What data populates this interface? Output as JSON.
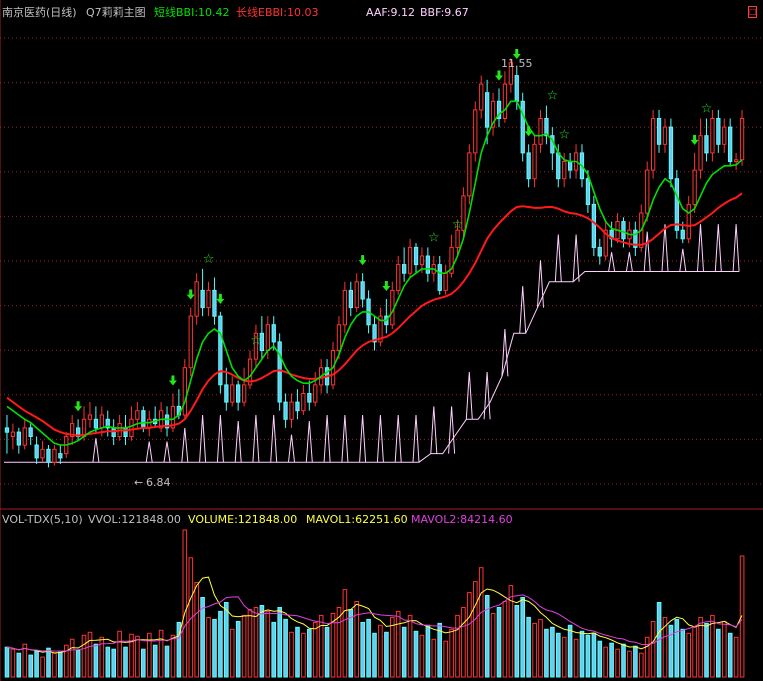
{
  "colors": {
    "up": "#ff3232",
    "down": "#54ffff",
    "down_fill": "#6cc8ec",
    "short_line": "#00e000",
    "long_line": "#ff1a1a",
    "aaf_line": "#ffd0ff",
    "grid": "#a02020",
    "arrow": "#22e81a",
    "mavol1": "#ffff40",
    "mavol2": "#e040e0",
    "label": "#c0c0c0"
  },
  "main_header": {
    "stock": "南京医药(日线)",
    "indicator": "Q7莉莉主图",
    "short_label": "短线BBI:10.42",
    "long_label": "长线EBBI:10.03",
    "aaf_label": "AAF:9.12",
    "bbf_label": "BBF:9.67"
  },
  "vol_header": {
    "name": "VOL-TDX(5,10)",
    "vvol": "VVOL:121848.00",
    "volume": "VOLUME:121848.00",
    "mavol1": "MAVOL1:62251.60",
    "mavol2": "MAVOL2:84214.60"
  },
  "annotations": {
    "high_label": "11.55",
    "low_label": "6.84"
  },
  "window_button_glyph": "□",
  "chart_data": [
    {
      "type": "candlestick",
      "title": "南京医药(日线) Q7莉莉主图",
      "price_range": [
        6.6,
        12.0
      ],
      "high_marker": 11.55,
      "low_marker": 6.84,
      "last_values": {
        "short_bbi": 10.42,
        "long_ebbi": 10.03,
        "aaf": 9.12,
        "bbf": 9.67
      },
      "candles": [
        [
          7.3,
          7.25,
          7.0,
          7.45
        ],
        [
          7.2,
          7.25,
          7.05,
          7.35
        ],
        [
          7.25,
          7.1,
          7.0,
          7.3
        ],
        [
          7.1,
          7.3,
          7.05,
          7.4
        ],
        [
          7.3,
          7.2,
          7.1,
          7.35
        ],
        [
          7.1,
          6.95,
          6.88,
          7.2
        ],
        [
          6.95,
          7.05,
          6.9,
          7.15
        ],
        [
          7.05,
          6.9,
          6.84,
          7.1
        ],
        [
          6.9,
          7.05,
          6.86,
          7.1
        ],
        [
          7.0,
          6.95,
          6.88,
          7.1
        ],
        [
          7.0,
          7.2,
          6.95,
          7.25
        ],
        [
          7.2,
          7.35,
          7.1,
          7.45
        ],
        [
          7.3,
          7.2,
          7.15,
          7.4
        ],
        [
          7.2,
          7.4,
          7.15,
          7.55
        ],
        [
          7.4,
          7.45,
          7.3,
          7.6
        ],
        [
          7.4,
          7.3,
          7.25,
          7.55
        ],
        [
          7.3,
          7.45,
          7.2,
          7.55
        ],
        [
          7.4,
          7.3,
          7.2,
          7.5
        ],
        [
          7.3,
          7.2,
          7.1,
          7.4
        ],
        [
          7.2,
          7.35,
          7.15,
          7.45
        ],
        [
          7.3,
          7.2,
          7.1,
          7.45
        ],
        [
          7.2,
          7.4,
          7.15,
          7.55
        ],
        [
          7.4,
          7.5,
          7.3,
          7.6
        ],
        [
          7.5,
          7.3,
          7.25,
          7.55
        ],
        [
          7.3,
          7.4,
          7.2,
          7.5
        ],
        [
          7.4,
          7.35,
          7.3,
          7.55
        ],
        [
          7.3,
          7.5,
          7.25,
          7.6
        ],
        [
          7.45,
          7.3,
          7.2,
          7.55
        ],
        [
          7.3,
          7.55,
          7.25,
          7.7
        ],
        [
          7.55,
          7.45,
          7.4,
          7.75
        ],
        [
          7.45,
          8.0,
          7.4,
          8.1
        ],
        [
          8.0,
          8.6,
          7.9,
          8.7
        ],
        [
          8.6,
          9.0,
          8.5,
          9.1
        ],
        [
          8.9,
          8.7,
          8.6,
          9.15
        ],
        [
          8.7,
          8.9,
          8.6,
          9.0
        ],
        [
          8.9,
          8.6,
          8.5,
          9.05
        ],
        [
          8.6,
          7.8,
          7.7,
          8.65
        ],
        [
          7.8,
          7.6,
          7.5,
          8.0
        ],
        [
          7.6,
          7.8,
          7.55,
          7.9
        ],
        [
          7.8,
          7.6,
          7.5,
          7.85
        ],
        [
          7.6,
          7.8,
          7.55,
          8.0
        ],
        [
          7.8,
          8.1,
          7.75,
          8.2
        ],
        [
          8.1,
          8.4,
          8.0,
          8.5
        ],
        [
          8.4,
          8.2,
          8.1,
          8.6
        ],
        [
          8.2,
          8.5,
          8.1,
          8.6
        ],
        [
          8.5,
          8.3,
          8.2,
          8.6
        ],
        [
          8.3,
          7.6,
          7.5,
          8.4
        ],
        [
          7.6,
          7.4,
          7.3,
          7.7
        ],
        [
          7.4,
          7.6,
          7.3,
          7.7
        ],
        [
          7.6,
          7.5,
          7.4,
          7.75
        ],
        [
          7.5,
          7.7,
          7.45,
          7.8
        ],
        [
          7.7,
          7.6,
          7.5,
          7.85
        ],
        [
          7.6,
          7.8,
          7.55,
          7.95
        ],
        [
          7.8,
          8.0,
          7.7,
          8.1
        ],
        [
          8.0,
          7.8,
          7.7,
          8.1
        ],
        [
          7.8,
          8.2,
          7.75,
          8.3
        ],
        [
          8.2,
          8.5,
          8.1,
          8.6
        ],
        [
          8.5,
          8.9,
          8.4,
          9.0
        ],
        [
          8.9,
          8.7,
          8.6,
          9.0
        ],
        [
          8.7,
          9.0,
          8.65,
          9.1
        ],
        [
          9.0,
          8.8,
          8.7,
          9.1
        ],
        [
          8.8,
          8.5,
          8.4,
          8.9
        ],
        [
          8.5,
          8.3,
          8.2,
          8.6
        ],
        [
          8.3,
          8.6,
          8.25,
          8.7
        ],
        [
          8.6,
          8.5,
          8.4,
          8.8
        ],
        [
          8.5,
          8.9,
          8.45,
          9.0
        ],
        [
          8.9,
          9.2,
          8.85,
          9.3
        ],
        [
          9.2,
          9.1,
          9.0,
          9.4
        ],
        [
          9.1,
          9.4,
          9.05,
          9.5
        ],
        [
          9.4,
          9.2,
          9.1,
          9.45
        ],
        [
          9.2,
          9.3,
          9.1,
          9.4
        ],
        [
          9.3,
          9.1,
          9.0,
          9.4
        ],
        [
          9.1,
          9.2,
          9.0,
          9.3
        ],
        [
          9.2,
          8.9,
          8.85,
          9.3
        ],
        [
          8.9,
          9.1,
          8.85,
          9.2
        ],
        [
          9.1,
          9.4,
          9.05,
          9.55
        ],
        [
          9.4,
          9.6,
          9.3,
          9.7
        ],
        [
          9.6,
          10.0,
          9.5,
          10.1
        ],
        [
          10.0,
          10.5,
          9.9,
          10.6
        ],
        [
          10.5,
          11.0,
          10.4,
          11.1
        ],
        [
          11.0,
          11.3,
          10.9,
          11.4
        ],
        [
          11.2,
          10.8,
          10.6,
          11.35
        ],
        [
          10.8,
          11.1,
          10.7,
          11.2
        ],
        [
          11.1,
          10.9,
          10.8,
          11.25
        ],
        [
          10.9,
          11.3,
          10.85,
          11.45
        ],
        [
          11.3,
          11.55,
          11.2,
          11.6
        ],
        [
          11.4,
          11.1,
          11.0,
          11.5
        ],
        [
          11.1,
          10.5,
          10.4,
          11.2
        ],
        [
          10.5,
          10.2,
          10.1,
          10.6
        ],
        [
          10.2,
          10.6,
          10.1,
          10.7
        ],
        [
          10.6,
          10.9,
          10.5,
          11.0
        ],
        [
          10.9,
          10.7,
          10.6,
          11.05
        ],
        [
          10.7,
          10.5,
          10.3,
          10.8
        ],
        [
          10.5,
          10.2,
          10.1,
          10.6
        ],
        [
          10.2,
          10.4,
          10.1,
          10.5
        ],
        [
          10.4,
          10.3,
          10.2,
          10.5
        ],
        [
          10.3,
          10.5,
          10.2,
          10.6
        ],
        [
          10.5,
          10.2,
          10.1,
          10.6
        ],
        [
          10.2,
          9.9,
          9.8,
          10.3
        ],
        [
          9.9,
          9.4,
          9.3,
          10.0
        ],
        [
          9.4,
          9.3,
          9.2,
          9.5
        ],
        [
          9.3,
          9.6,
          9.25,
          9.7
        ],
        [
          9.6,
          9.5,
          9.4,
          9.7
        ],
        [
          9.5,
          9.7,
          9.45,
          9.8
        ],
        [
          9.7,
          9.5,
          9.4,
          9.75
        ],
        [
          9.5,
          9.6,
          9.4,
          9.7
        ],
        [
          9.6,
          9.4,
          9.3,
          9.7
        ],
        [
          9.4,
          9.8,
          9.35,
          9.9
        ],
        [
          9.8,
          10.3,
          9.7,
          10.4
        ],
        [
          10.3,
          10.9,
          10.2,
          11.0
        ],
        [
          10.9,
          10.6,
          10.5,
          11.0
        ],
        [
          10.6,
          10.8,
          10.5,
          10.9
        ],
        [
          10.8,
          10.2,
          10.1,
          10.9
        ],
        [
          10.2,
          9.6,
          9.5,
          10.3
        ],
        [
          9.6,
          9.5,
          9.45,
          9.7
        ],
        [
          9.5,
          9.9,
          9.45,
          10.0
        ],
        [
          9.9,
          10.3,
          9.8,
          10.5
        ],
        [
          10.3,
          10.7,
          10.2,
          10.9
        ],
        [
          10.7,
          10.5,
          10.4,
          10.9
        ],
        [
          10.5,
          10.9,
          10.4,
          11.0
        ],
        [
          10.9,
          10.6,
          10.5,
          11.0
        ],
        [
          10.6,
          10.8,
          10.5,
          10.9
        ],
        [
          10.8,
          10.4,
          10.35,
          10.9
        ],
        [
          10.4,
          10.42,
          10.3,
          10.5
        ],
        [
          10.42,
          10.9,
          10.35,
          11.0
        ]
      ],
      "short_bbi": [
        7.55,
        7.5,
        7.45,
        7.4,
        7.36,
        7.3,
        7.24,
        7.18,
        7.12,
        7.1,
        7.1,
        7.12,
        7.15,
        7.2,
        7.25,
        7.28,
        7.3,
        7.32,
        7.3,
        7.3,
        7.3,
        7.32,
        7.35,
        7.36,
        7.36,
        7.38,
        7.4,
        7.4,
        7.4,
        7.45,
        7.6,
        7.85,
        8.1,
        8.3,
        8.4,
        8.45,
        8.4,
        8.2,
        8.0,
        7.9,
        7.85,
        7.9,
        8.0,
        8.1,
        8.2,
        8.25,
        8.15,
        8.0,
        7.9,
        7.85,
        7.82,
        7.82,
        7.85,
        7.9,
        7.95,
        8.0,
        8.15,
        8.35,
        8.5,
        8.6,
        8.65,
        8.65,
        8.6,
        8.55,
        8.55,
        8.65,
        8.8,
        8.95,
        9.05,
        9.1,
        9.15,
        9.15,
        9.15,
        9.1,
        9.1,
        9.15,
        9.3,
        9.5,
        9.8,
        10.15,
        10.5,
        10.7,
        10.85,
        10.95,
        11.0,
        11.1,
        11.1,
        10.95,
        10.8,
        10.7,
        10.7,
        10.72,
        10.65,
        10.5,
        10.42,
        10.4,
        10.4,
        10.35,
        10.25,
        10.05,
        9.85,
        9.7,
        9.62,
        9.6,
        9.58,
        9.55,
        9.55,
        9.6,
        9.75,
        9.95,
        10.1,
        10.2,
        10.15,
        10.0,
        9.85,
        9.8,
        9.85,
        10.0,
        10.15,
        10.25,
        10.3,
        10.35,
        10.35,
        10.36,
        10.42
      ],
      "long_ebbi": [
        7.65,
        7.6,
        7.55,
        7.5,
        7.46,
        7.42,
        7.38,
        7.33,
        7.28,
        7.25,
        7.23,
        7.22,
        7.21,
        7.22,
        7.23,
        7.24,
        7.25,
        7.26,
        7.26,
        7.27,
        7.27,
        7.28,
        7.29,
        7.3,
        7.3,
        7.31,
        7.32,
        7.32,
        7.33,
        7.35,
        7.4,
        7.5,
        7.62,
        7.75,
        7.85,
        7.92,
        7.96,
        7.95,
        7.92,
        7.88,
        7.85,
        7.84,
        7.85,
        7.88,
        7.92,
        7.96,
        7.97,
        7.95,
        7.92,
        7.9,
        7.88,
        7.87,
        7.87,
        7.88,
        7.9,
        7.92,
        7.97,
        8.04,
        8.12,
        8.2,
        8.26,
        8.3,
        8.32,
        8.34,
        8.36,
        8.4,
        8.46,
        8.53,
        8.6,
        8.66,
        8.72,
        8.76,
        8.79,
        8.81,
        8.83,
        8.86,
        8.92,
        9.0,
        9.1,
        9.22,
        9.36,
        9.5,
        9.6,
        9.68,
        9.75,
        9.82,
        9.87,
        9.88,
        9.87,
        9.86,
        9.86,
        9.87,
        9.87,
        9.85,
        9.82,
        9.8,
        9.79,
        9.77,
        9.74,
        9.69,
        9.63,
        9.56,
        9.51,
        9.48,
        9.46,
        9.44,
        9.43,
        9.43,
        9.45,
        9.5,
        9.56,
        9.62,
        9.66,
        9.67,
        9.66,
        9.65,
        9.66,
        9.7,
        9.75,
        9.8,
        9.86,
        9.91,
        9.95,
        9.98,
        10.03
      ],
      "aaf_steps": [
        [
          0,
          6.9
        ],
        [
          30,
          6.9
        ],
        [
          38,
          6.9
        ],
        [
          42,
          6.9
        ],
        [
          46,
          6.9
        ],
        [
          50,
          6.9
        ],
        [
          56,
          6.9
        ],
        [
          70,
          6.9
        ],
        [
          72,
          7.0
        ],
        [
          74,
          7.0
        ],
        [
          76,
          7.2
        ],
        [
          78,
          7.4
        ],
        [
          80,
          7.4
        ],
        [
          82,
          7.6
        ],
        [
          84,
          7.9
        ],
        [
          86,
          8.4
        ],
        [
          88,
          8.4
        ],
        [
          90,
          8.7
        ],
        [
          92,
          9.0
        ],
        [
          96,
          9.0
        ],
        [
          98,
          9.12
        ],
        [
          124,
          9.12
        ]
      ],
      "buy_arrows": [
        12,
        28,
        31,
        36,
        60,
        64,
        83,
        86,
        88,
        116
      ],
      "stars": [
        33,
        41,
        71,
        75,
        91,
        93,
        117
      ]
    },
    {
      "type": "bar",
      "title": "VOL-TDX(5,10)",
      "value_range": [
        0,
        150000
      ],
      "volumes": [
        30000,
        28000,
        24000,
        33000,
        22000,
        26000,
        20000,
        29000,
        24000,
        25000,
        32000,
        38000,
        27000,
        42000,
        45000,
        33000,
        40000,
        30000,
        28000,
        46000,
        30000,
        43000,
        41000,
        28000,
        44000,
        32000,
        47000,
        31000,
        42000,
        55000,
        148000,
        120000,
        95000,
        80000,
        60000,
        58000,
        66000,
        75000,
        48000,
        56000,
        62000,
        68000,
        70000,
        72000,
        66000,
        55000,
        70000,
        58000,
        45000,
        50000,
        44000,
        48000,
        55000,
        62000,
        50000,
        64000,
        70000,
        88000,
        68000,
        76000,
        55000,
        58000,
        44000,
        52000,
        45000,
        60000,
        66000,
        50000,
        62000,
        46000,
        42000,
        52000,
        38000,
        54000,
        36000,
        48000,
        62000,
        70000,
        85000,
        96000,
        110000,
        82000,
        64000,
        70000,
        76000,
        92000,
        72000,
        80000,
        60000,
        54000,
        58000,
        48000,
        50000,
        44000,
        40000,
        52000,
        38000,
        46000,
        42000,
        44000,
        36000,
        30000,
        34000,
        28000,
        33000,
        26000,
        31000,
        24000,
        40000,
        56000,
        75000,
        60000,
        52000,
        58000,
        48000,
        44000,
        50000,
        60000,
        54000,
        62000,
        48000,
        56000,
        44000,
        40000,
        121848
      ],
      "mavol1_last": 62251.6,
      "mavol2_last": 84214.6
    }
  ]
}
